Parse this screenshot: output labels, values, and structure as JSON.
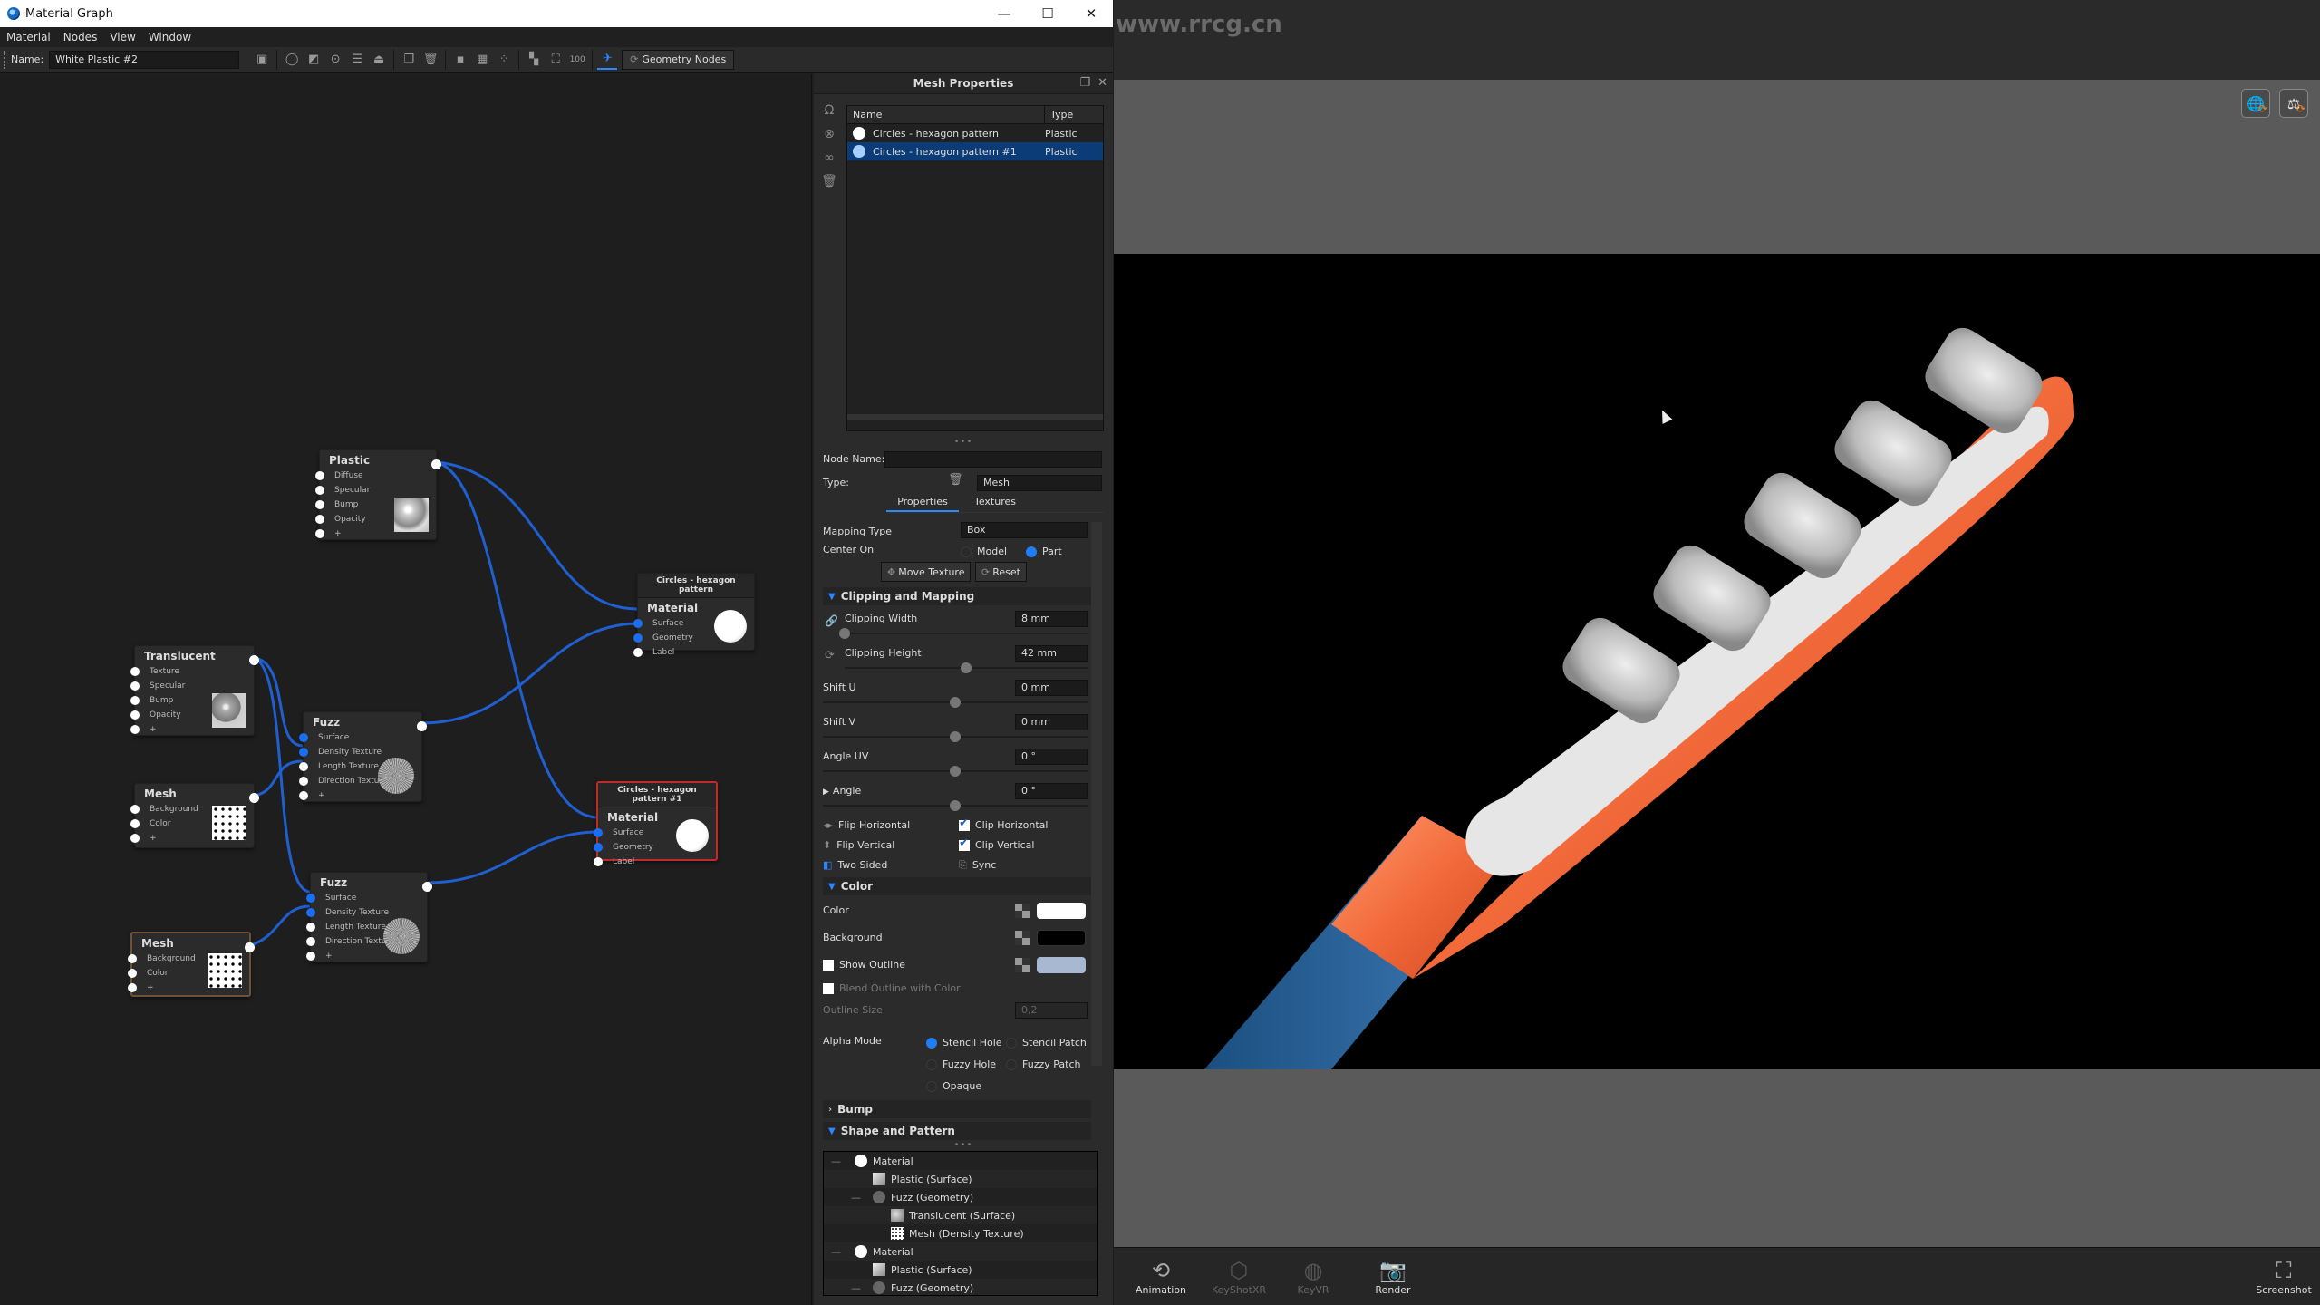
{
  "window": {
    "title": "Material Graph",
    "controls": {
      "minimize": "—",
      "maximize": "☐",
      "close": "✕"
    }
  },
  "menu": [
    "Material",
    "Nodes",
    "View",
    "Window"
  ],
  "toolbar": {
    "name_label": "Name:",
    "name_value": "White Plastic #2",
    "geometry_nodes_label": "Geometry Nodes",
    "icons": [
      "save-icon",
      "material-preview-icon",
      "checker-icon",
      "play-icon",
      "sliders-icon",
      "weight-icon",
      "duplicate-icon",
      "delete-icon",
      "add-node-icon",
      "add-texture-icon",
      "add-label-icon",
      "arrange-icon",
      "fit-icon",
      "zoom-100-icon",
      "graph-direction-icon"
    ]
  },
  "graph": {
    "nodes": {
      "plastic": {
        "title": "Plastic",
        "ports": [
          "Diffuse",
          "Specular",
          "Bump",
          "Opacity",
          "+"
        ]
      },
      "translucent": {
        "title": "Translucent",
        "ports": [
          "Texture",
          "Specular",
          "Bump",
          "Opacity",
          "+"
        ]
      },
      "fuzz1": {
        "title": "Fuzz",
        "ports": [
          "Surface",
          "Density Texture",
          "Length Texture",
          "Direction Texture",
          "+"
        ]
      },
      "fuzz2": {
        "title": "Fuzz",
        "ports": [
          "Surface",
          "Density Texture",
          "Length Texture",
          "Direction Texture",
          "+"
        ]
      },
      "mesh1": {
        "title": "Mesh",
        "ports": [
          "Background",
          "Color",
          "+"
        ]
      },
      "mesh2": {
        "title": "Mesh",
        "ports": [
          "Background",
          "Color",
          "+"
        ]
      },
      "material1": {
        "header": "Circles - hexagon pattern",
        "title": "Material",
        "ports": [
          "Surface",
          "Geometry",
          "Label"
        ]
      },
      "material2": {
        "header": "Circles - hexagon pattern #1",
        "title": "Material",
        "ports": [
          "Surface",
          "Geometry",
          "Label"
        ]
      }
    },
    "wire_color": "#1f5fd0"
  },
  "props": {
    "title": "Mesh Properties",
    "list": {
      "headers": {
        "name": "Name",
        "type": "Type"
      },
      "rows": [
        {
          "name": "Circles - hexagon pattern",
          "type": "Plastic",
          "selected": false
        },
        {
          "name": "Circles - hexagon pattern #1",
          "type": "Plastic",
          "selected": true
        }
      ]
    },
    "node_name_label": "Node Name:",
    "node_name_value": "",
    "type_label": "Type:",
    "type_value": "Mesh",
    "tabs": [
      "Properties",
      "Textures"
    ],
    "active_tab": "Properties",
    "mapping_type_label": "Mapping Type",
    "mapping_type_value": "Box",
    "center_on_label": "Center On",
    "center_on_options": [
      "Model",
      "Part"
    ],
    "center_on_selected": "Part",
    "move_texture_label": "Move Texture",
    "reset_label": "Reset",
    "clipping_section": "Clipping and Mapping",
    "clipping_width": {
      "label": "Clipping Width",
      "value": "8 mm",
      "slider": 0.0
    },
    "clipping_height": {
      "label": "Clipping Height",
      "value": "42 mm",
      "slider": 0.5
    },
    "shift_u": {
      "label": "Shift U",
      "value": "0 mm",
      "slider": 0.5
    },
    "shift_v": {
      "label": "Shift V",
      "value": "0 mm",
      "slider": 0.5
    },
    "angle_uv": {
      "label": "Angle UV",
      "value": "0 °",
      "slider": 0.5
    },
    "angle": {
      "label": "Angle",
      "value": "0 °",
      "slider": 0.5
    },
    "flip_horizontal": "Flip Horizontal",
    "flip_vertical": "Flip Vertical",
    "two_sided": "Two Sided",
    "clip_horizontal": {
      "label": "Clip Horizontal",
      "checked": true
    },
    "clip_vertical": {
      "label": "Clip Vertical",
      "checked": true
    },
    "sync": "Sync",
    "color_section": "Color",
    "color": {
      "label": "Color",
      "value": "#ffffff"
    },
    "background": {
      "label": "Background",
      "value": "#000000"
    },
    "show_outline": {
      "label": "Show Outline",
      "checked": false,
      "value": "#a8b8d0"
    },
    "blend_outline": {
      "label": "Blend Outline with Color",
      "checked": false
    },
    "outline_size": {
      "label": "Outline Size",
      "value": "0,2"
    },
    "alpha_mode_label": "Alpha Mode",
    "alpha_modes": [
      "Stencil Hole",
      "Stencil Patch",
      "Fuzzy Hole",
      "Fuzzy Patch",
      "Opaque"
    ],
    "alpha_mode_selected": "Stencil Hole",
    "bump_section": "Bump",
    "shape_section": "Shape and Pattern",
    "tree": [
      {
        "label": "Material",
        "glyph": "ball",
        "level": 0
      },
      {
        "label": "Plastic (Surface)",
        "glyph": "plastic",
        "level": 1
      },
      {
        "label": "Fuzz (Geometry)",
        "glyph": "fuzz",
        "level": 1
      },
      {
        "label": "Translucent (Surface)",
        "glyph": "translucent",
        "level": 2
      },
      {
        "label": "Mesh (Density Texture)",
        "glyph": "mesh",
        "level": 2
      },
      {
        "label": "Material",
        "glyph": "ball",
        "level": 0
      },
      {
        "label": "Plastic (Surface)",
        "glyph": "plastic",
        "level": 1
      },
      {
        "label": "Fuzz (Geometry)",
        "glyph": "fuzz",
        "level": 1
      }
    ]
  },
  "viewport": {
    "watermark": "www.rrcg.cn",
    "top_icons": [
      "environment-refresh-icon",
      "material-refresh-icon"
    ],
    "bottom_bar": [
      {
        "label": "Animation",
        "icon": "⟲",
        "enabled": true
      },
      {
        "label": "KeyShotXR",
        "icon": "⬡",
        "enabled": false
      },
      {
        "label": "KeyVR",
        "icon": "◍",
        "enabled": false
      },
      {
        "label": "Render",
        "icon": "📷",
        "enabled": true
      }
    ],
    "screenshot_label": "Screenshot"
  }
}
